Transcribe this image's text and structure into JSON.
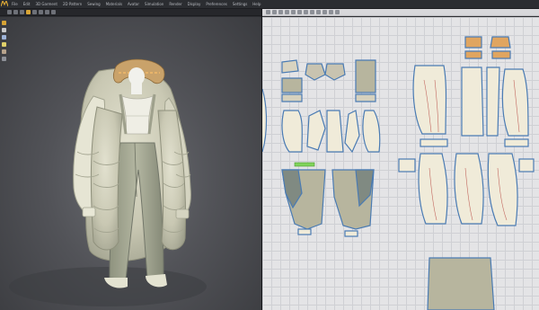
{
  "app": {
    "logo_icon": "app-logo-icon",
    "menu": [
      "File",
      "Edit",
      "3D Garment",
      "2D Pattern",
      "Sewing",
      "Materials",
      "Avatar",
      "Simulation",
      "Render",
      "Display",
      "Preferences",
      "Settings",
      "Help"
    ]
  },
  "toolbar3d": {
    "tools": [
      "select-icon",
      "move-icon",
      "rotate-icon",
      "simulate-icon",
      "pin-icon",
      "brush-icon",
      "fold-icon",
      "tack-icon"
    ],
    "active_index": 3
  },
  "toolbar2d": {
    "tools": [
      "transform-icon",
      "edit-point-icon",
      "polygon-icon",
      "rectangle-icon",
      "circle-icon",
      "internal-line-icon",
      "dart-icon",
      "seam-icon",
      "notch-icon",
      "segment-sew-icon",
      "free-sew-icon",
      "check-sewing-icon"
    ]
  },
  "sidetools": [
    "layer-icon",
    "avatar-icon",
    "camera-icon",
    "light-icon",
    "texture-icon",
    "grid-icon"
  ],
  "colors": {
    "viewport_bg": "#525358",
    "pattern_fill": "#f0ebd9",
    "pattern_shadow_fill": "#b7b59e",
    "pattern_outline": "#4a7bb3",
    "fabric_main": "#c8c7b2",
    "fabric_accent": "#d89b52"
  }
}
